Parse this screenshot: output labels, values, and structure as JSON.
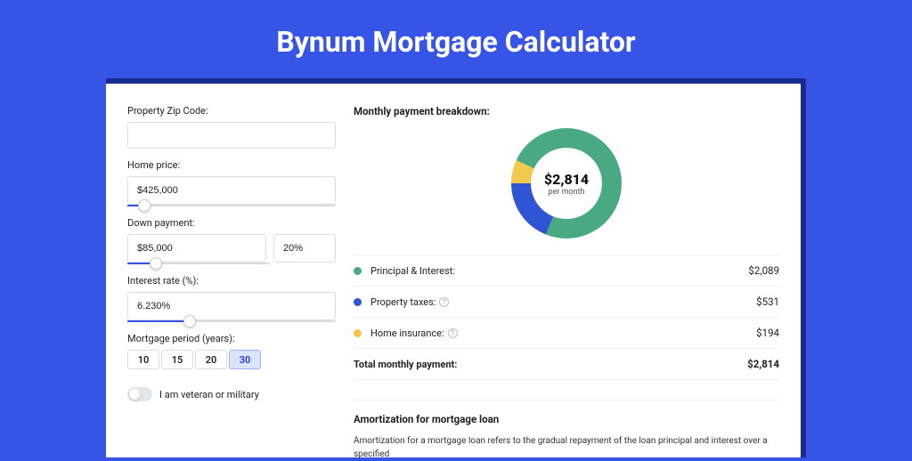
{
  "title": "Bynum Mortgage Calculator",
  "colors": {
    "principal": "#49a983",
    "taxes": "#2f55d4",
    "insurance": "#f2c94c"
  },
  "form": {
    "zip_label": "Property Zip Code:",
    "zip_value": "",
    "home_price_label": "Home price:",
    "home_price_value": "$425,000",
    "home_price_slider_pct": 8,
    "down_payment_label": "Down payment:",
    "down_payment_value": "$85,000",
    "down_payment_pct_value": "20%",
    "down_payment_slider_pct": 20,
    "interest_label": "Interest rate (%):",
    "interest_value": "6.230%",
    "interest_slider_pct": 30,
    "period_label": "Mortgage period (years):",
    "period_options": [
      "10",
      "15",
      "20",
      "30"
    ],
    "period_selected": "30",
    "veteran_label": "I am veteran or military",
    "veteran_on": false
  },
  "breakdown": {
    "title": "Monthly payment breakdown:",
    "center_amount": "$2,814",
    "center_sub": "per month",
    "items": [
      {
        "label": "Principal & Interest:",
        "value": "$2,089",
        "color_key": "principal",
        "help": false
      },
      {
        "label": "Property taxes:",
        "value": "$531",
        "color_key": "taxes",
        "help": true
      },
      {
        "label": "Home insurance:",
        "value": "$194",
        "color_key": "insurance",
        "help": true
      }
    ],
    "total_label": "Total monthly payment:",
    "total_value": "$2,814"
  },
  "amortization": {
    "title": "Amortization for mortgage loan",
    "text": "Amortization for a mortgage loan refers to the gradual repayment of the loan principal and interest over a specified"
  },
  "chart_data": {
    "type": "pie",
    "title": "Monthly payment breakdown",
    "series": [
      {
        "name": "Principal & Interest",
        "value": 2089
      },
      {
        "name": "Property taxes",
        "value": 531
      },
      {
        "name": "Home insurance",
        "value": 194
      }
    ],
    "total": 2814,
    "center_label": "$2,814 per month"
  }
}
